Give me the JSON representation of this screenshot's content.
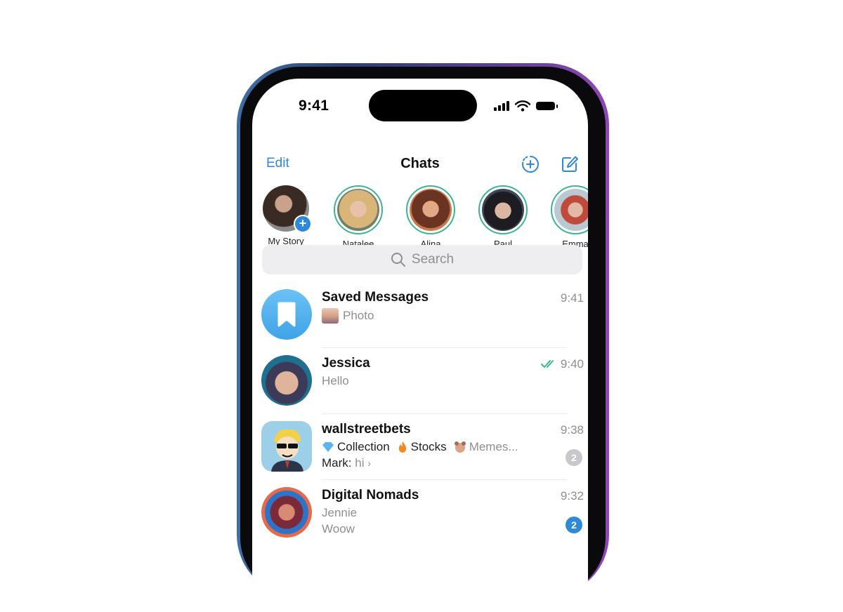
{
  "status_bar": {
    "time": "9:41"
  },
  "nav": {
    "edit": "Edit",
    "title": "Chats"
  },
  "stories": [
    {
      "name": "My Story"
    },
    {
      "name": "Natalee"
    },
    {
      "name": "Alina"
    },
    {
      "name": "Paul"
    },
    {
      "name": "Emma"
    }
  ],
  "search": {
    "placeholder": "Search"
  },
  "chats": [
    {
      "name": "Saved Messages",
      "time": "9:41",
      "preview": "Photo"
    },
    {
      "name": "Jessica",
      "time": "9:40",
      "preview": "Hello"
    },
    {
      "name": "wallstreetbets",
      "time": "9:38",
      "topic1": "Collection",
      "topic2": "Stocks",
      "topic3": "Memes...",
      "sender": "Mark:",
      "preview": "hi",
      "unread": "2"
    },
    {
      "name": "Digital Nomads",
      "time": "9:32",
      "sender": "Jennie",
      "preview": "Woow",
      "unread": "2"
    }
  ],
  "colors": {
    "accent": "#2e8ad6",
    "story_ring": "#3ab68f",
    "muted_badge": "#c7c7cc",
    "read_check": "#3ab68f"
  }
}
